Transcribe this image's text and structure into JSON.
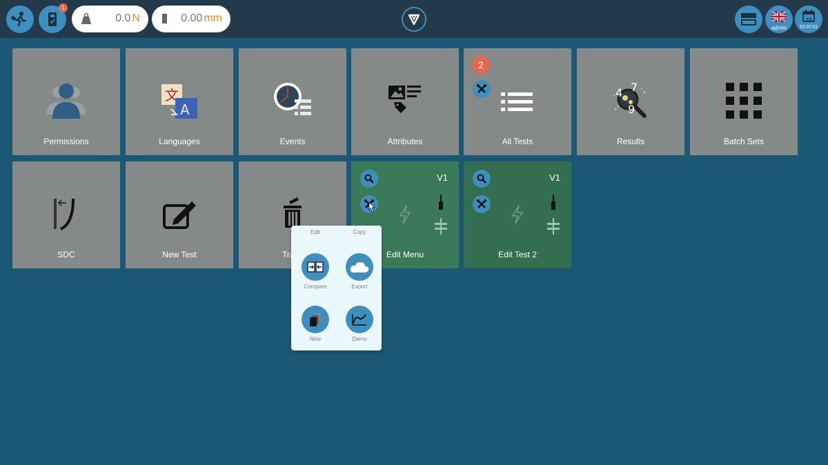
{
  "topbar": {
    "notification_count": "1",
    "force": {
      "value": "0.0",
      "unit": "N"
    },
    "position": {
      "value": "0.00",
      "unit": "mm"
    },
    "user": "admin",
    "date_day": "23",
    "time": "10:07:01"
  },
  "tiles": {
    "permissions": "Permissions",
    "languages": "Languages",
    "events": "Events",
    "attributes": "Attributes",
    "all_tests": "All Tests",
    "all_tests_badge": "2",
    "results": "Results",
    "batch_sets": "Batch Sets",
    "sdc": "SDC",
    "new_test": "New Test",
    "trash_partial": "Tra",
    "edit_menu": "Edit Menu",
    "edit_menu_version": "V1",
    "edit_test_2": "Edit Test 2",
    "edit_test_2_version": "V1",
    "results_digits": [
      "4",
      "7",
      "9"
    ]
  },
  "popup": {
    "edit": "Edit",
    "copy": "Copy",
    "compare": "Compare",
    "export": "Export",
    "new": "New",
    "demo": "Demo"
  },
  "colors": {
    "background": "#1b5876",
    "topbar": "#243a4b",
    "accent": "#3d8fbf",
    "tile_gray": "#858a88",
    "tile_green": "#3b7a59",
    "badge": "#e8684f",
    "unit_orange": "#e08a2c"
  }
}
